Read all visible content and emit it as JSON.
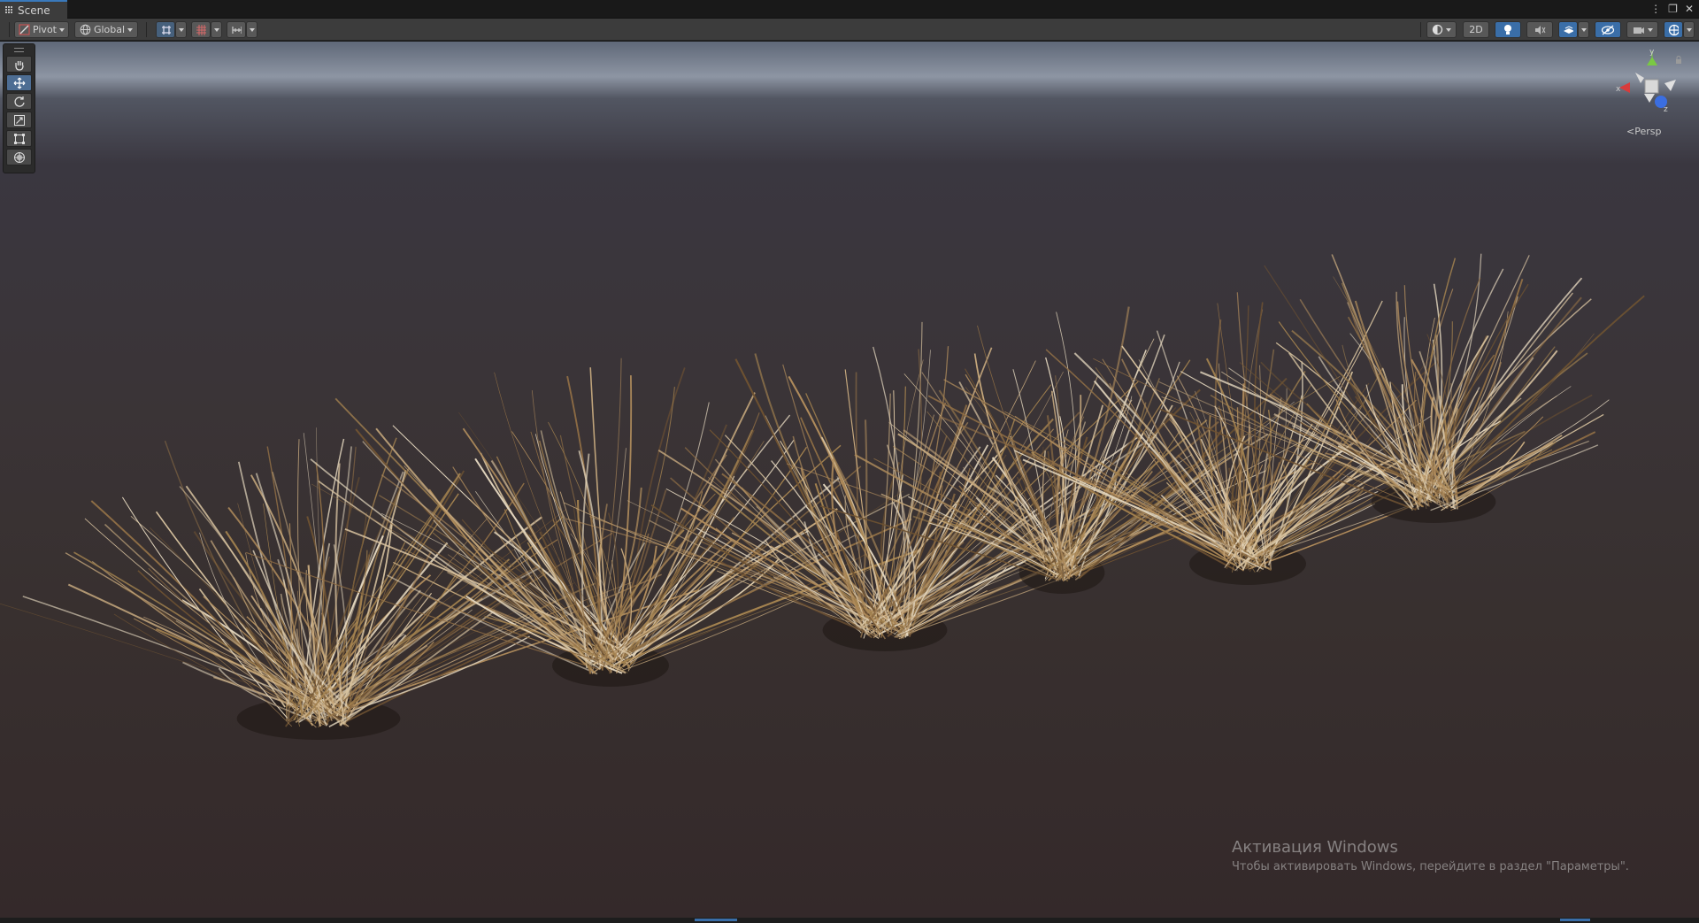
{
  "tab": {
    "label": "Scene",
    "icon": "grid-icon"
  },
  "window_controls": {
    "more": "⋮",
    "maximize": "❐",
    "close": "✕"
  },
  "toolbar": {
    "pivot_label": "Pivot",
    "global_label": "Global",
    "two_d_label": "2D",
    "icons": [
      "handle-position-icon",
      "handle-rotation-icon",
      "snap-grid-icon",
      "grid-toggle-icon",
      "increment-snap-icon",
      "draw-mode-icon",
      "lighting-icon",
      "audio-icon",
      "effects-icon",
      "visibility-icon",
      "camera-icon",
      "gizmos-icon"
    ]
  },
  "tools": [
    "hand-tool-icon",
    "move-tool-icon",
    "rotate-tool-icon",
    "scale-tool-icon",
    "rect-tool-icon",
    "transform-tool-icon"
  ],
  "gizmo": {
    "x_label": "x",
    "y_label": "y",
    "z_label": "z",
    "projection": "Persp"
  },
  "watermark": {
    "title": "Активация Windows",
    "subtitle": "Чтобы активировать Windows, перейдите в раздел \"Параметры\"."
  },
  "colors": {
    "accent": "#3a79bb",
    "gizmo_x": "#d83b3b",
    "gizmo_y": "#7ac943",
    "gizmo_z": "#3b6ee0"
  }
}
